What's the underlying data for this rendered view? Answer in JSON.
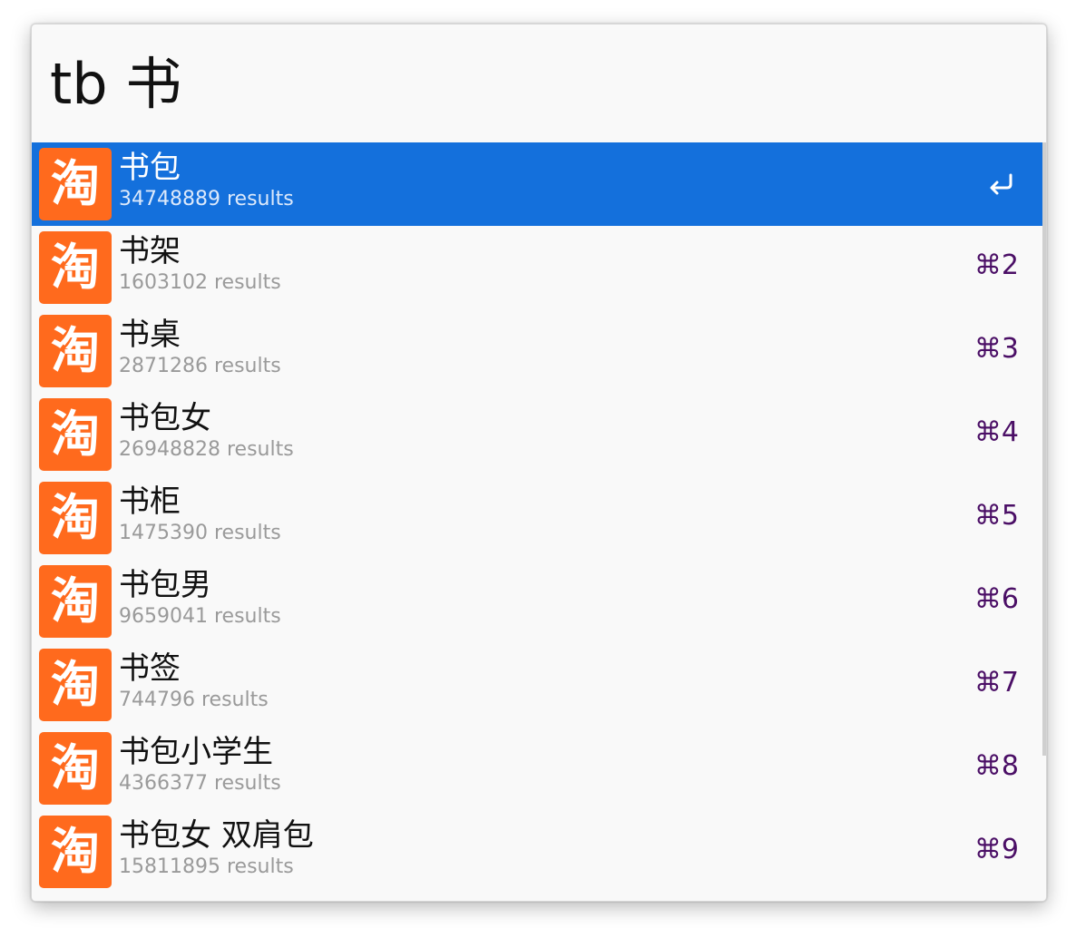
{
  "search": {
    "query": "tb 书"
  },
  "results": [
    {
      "title": "书包",
      "subtitle": "34748889 results",
      "shortcut": "",
      "icon": "taobao-icon",
      "icon_glyph": "淘",
      "selected": true
    },
    {
      "title": "书架",
      "subtitle": "1603102 results",
      "shortcut": "⌘2",
      "icon": "taobao-icon",
      "icon_glyph": "淘"
    },
    {
      "title": "书桌",
      "subtitle": "2871286 results",
      "shortcut": "⌘3",
      "icon": "taobao-icon",
      "icon_glyph": "淘"
    },
    {
      "title": "书包女",
      "subtitle": "26948828 results",
      "shortcut": "⌘4",
      "icon": "taobao-icon",
      "icon_glyph": "淘"
    },
    {
      "title": "书柜",
      "subtitle": "1475390 results",
      "shortcut": "⌘5",
      "icon": "taobao-icon",
      "icon_glyph": "淘"
    },
    {
      "title": "书包男",
      "subtitle": "9659041 results",
      "shortcut": "⌘6",
      "icon": "taobao-icon",
      "icon_glyph": "淘"
    },
    {
      "title": "书签",
      "subtitle": "744796 results",
      "shortcut": "⌘7",
      "icon": "taobao-icon",
      "icon_glyph": "淘"
    },
    {
      "title": "书包小学生",
      "subtitle": "4366377 results",
      "shortcut": "⌘8",
      "icon": "taobao-icon",
      "icon_glyph": "淘"
    },
    {
      "title": "书包女 双肩包",
      "subtitle": "15811895 results",
      "shortcut": "⌘9",
      "icon": "taobao-icon",
      "icon_glyph": "淘"
    }
  ],
  "colors": {
    "selection": "#1470dc",
    "icon_background": "#ff6a1d",
    "shortcut": "#4b0f66",
    "subtitle": "#9a9a9a"
  }
}
